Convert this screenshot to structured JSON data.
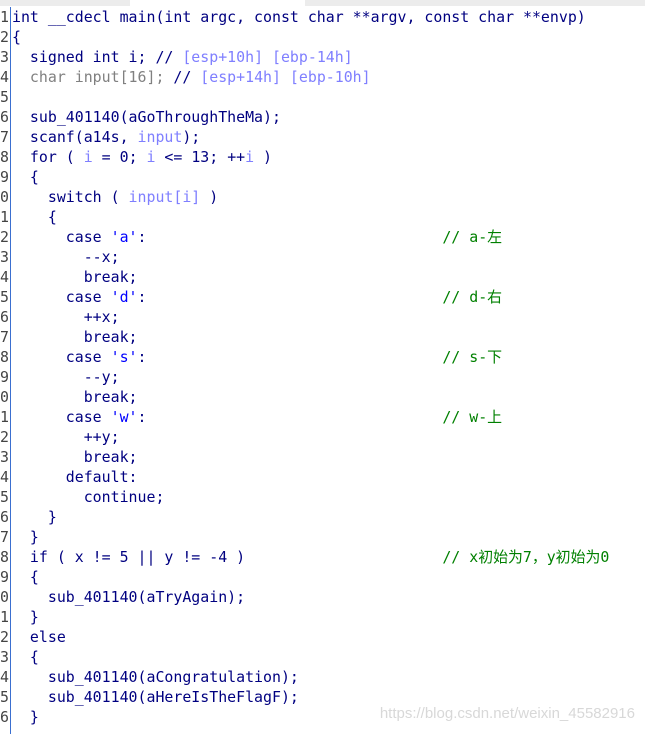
{
  "lines": [
    {
      "num": "1",
      "segs": [
        [
          "kw",
          "int __cdecl main(int argc, const char **argv, const char **envp)"
        ]
      ]
    },
    {
      "num": "2",
      "segs": [
        [
          "kw",
          "{"
        ]
      ]
    },
    {
      "num": "3",
      "segs": [
        [
          "kw",
          "  signed int i; // "
        ],
        [
          "cm",
          "[esp+10h] [ebp-14h]"
        ]
      ]
    },
    {
      "num": "4",
      "segs": [
        [
          "gr",
          "  char input[16]; "
        ],
        [
          "kw",
          "// "
        ],
        [
          "cm",
          "[esp+14h] [ebp-10h]"
        ]
      ]
    },
    {
      "num": "5",
      "segs": []
    },
    {
      "num": "6",
      "segs": [
        [
          "kw",
          "  sub_401140(aGoThroughTheMa);"
        ]
      ]
    },
    {
      "num": "7",
      "segs": [
        [
          "kw",
          "  scanf(a14s, "
        ],
        [
          "lv",
          "input"
        ],
        [
          "kw",
          ");"
        ]
      ]
    },
    {
      "num": "8",
      "segs": [
        [
          "kw",
          "  for ( "
        ],
        [
          "lv",
          "i"
        ],
        [
          "kw",
          " = 0; "
        ],
        [
          "lv",
          "i"
        ],
        [
          "kw",
          " <= 13; ++"
        ],
        [
          "lv",
          "i"
        ],
        [
          "kw",
          " )"
        ]
      ]
    },
    {
      "num": "9",
      "segs": [
        [
          "kw",
          "  {"
        ]
      ]
    },
    {
      "num": "0",
      "segs": [
        [
          "kw",
          "    switch ( "
        ],
        [
          "lv",
          "input[i]"
        ],
        [
          "kw",
          " )"
        ]
      ]
    },
    {
      "num": "1",
      "segs": [
        [
          "kw",
          "    {"
        ]
      ]
    },
    {
      "num": "2",
      "segs": [
        [
          "kw",
          "      case "
        ],
        [
          "ch",
          "'a'"
        ],
        [
          "kw",
          ":                                 "
        ],
        [
          "gc",
          "// a-左"
        ]
      ]
    },
    {
      "num": "3",
      "segs": [
        [
          "kw",
          "        --x;"
        ]
      ]
    },
    {
      "num": "4",
      "segs": [
        [
          "kw",
          "        break;"
        ]
      ]
    },
    {
      "num": "5",
      "segs": [
        [
          "kw",
          "      case "
        ],
        [
          "ch",
          "'d'"
        ],
        [
          "kw",
          ":                                 "
        ],
        [
          "gc",
          "// d-右"
        ]
      ]
    },
    {
      "num": "6",
      "segs": [
        [
          "kw",
          "        ++x;"
        ]
      ]
    },
    {
      "num": "7",
      "segs": [
        [
          "kw",
          "        break;"
        ]
      ]
    },
    {
      "num": "8",
      "segs": [
        [
          "kw",
          "      case "
        ],
        [
          "ch",
          "'s'"
        ],
        [
          "kw",
          ":                                 "
        ],
        [
          "gc",
          "// s-下"
        ]
      ]
    },
    {
      "num": "9",
      "segs": [
        [
          "kw",
          "        --y;"
        ]
      ]
    },
    {
      "num": "0",
      "segs": [
        [
          "kw",
          "        break;"
        ]
      ]
    },
    {
      "num": "1",
      "segs": [
        [
          "kw",
          "      case "
        ],
        [
          "ch",
          "'w'"
        ],
        [
          "kw",
          ":                                 "
        ],
        [
          "gc",
          "// w-上"
        ]
      ]
    },
    {
      "num": "2",
      "segs": [
        [
          "kw",
          "        ++y;"
        ]
      ]
    },
    {
      "num": "3",
      "segs": [
        [
          "kw",
          "        break;"
        ]
      ]
    },
    {
      "num": "4",
      "segs": [
        [
          "kw",
          "      default:"
        ]
      ]
    },
    {
      "num": "5",
      "segs": [
        [
          "kw",
          "        continue;"
        ]
      ]
    },
    {
      "num": "6",
      "segs": [
        [
          "kw",
          "    }"
        ]
      ]
    },
    {
      "num": "7",
      "segs": [
        [
          "kw",
          "  }"
        ]
      ]
    },
    {
      "num": "8",
      "segs": [
        [
          "kw",
          "  if ( x != 5 || y != -4 )                      "
        ],
        [
          "gc",
          "// x初始为7，y初始为0"
        ]
      ]
    },
    {
      "num": "9",
      "segs": [
        [
          "kw",
          "  {"
        ]
      ]
    },
    {
      "num": "0",
      "segs": [
        [
          "kw",
          "    sub_401140(aTryAgain);"
        ]
      ]
    },
    {
      "num": "1",
      "segs": [
        [
          "kw",
          "  }"
        ]
      ]
    },
    {
      "num": "2",
      "segs": [
        [
          "kw",
          "  else"
        ]
      ]
    },
    {
      "num": "3",
      "segs": [
        [
          "kw",
          "  {"
        ]
      ]
    },
    {
      "num": "4",
      "segs": [
        [
          "kw",
          "    sub_401140(aCongratulation);"
        ]
      ]
    },
    {
      "num": "5",
      "segs": [
        [
          "kw",
          "    sub_401140(aHereIsTheFlagF);"
        ]
      ]
    },
    {
      "num": "6",
      "segs": [
        [
          "kw",
          "  }"
        ]
      ]
    }
  ],
  "watermark": "https://blog.csdn.net/weixin_45582916"
}
